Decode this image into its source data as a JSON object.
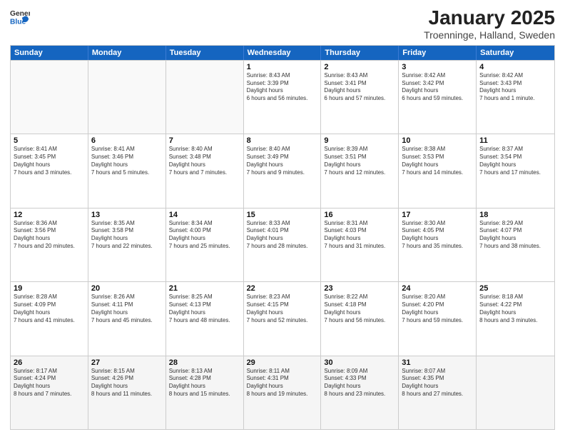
{
  "logo": {
    "general": "General",
    "blue": "Blue"
  },
  "header": {
    "month": "January 2025",
    "location": "Troenninge, Halland, Sweden"
  },
  "days": [
    "Sunday",
    "Monday",
    "Tuesday",
    "Wednesday",
    "Thursday",
    "Friday",
    "Saturday"
  ],
  "rows": [
    [
      {
        "day": "",
        "empty": true
      },
      {
        "day": "",
        "empty": true
      },
      {
        "day": "",
        "empty": true
      },
      {
        "day": "1",
        "sunrise": "8:43 AM",
        "sunset": "3:39 PM",
        "daylight": "6 hours and 56 minutes."
      },
      {
        "day": "2",
        "sunrise": "8:43 AM",
        "sunset": "3:41 PM",
        "daylight": "6 hours and 57 minutes."
      },
      {
        "day": "3",
        "sunrise": "8:42 AM",
        "sunset": "3:42 PM",
        "daylight": "6 hours and 59 minutes."
      },
      {
        "day": "4",
        "sunrise": "8:42 AM",
        "sunset": "3:43 PM",
        "daylight": "7 hours and 1 minute."
      }
    ],
    [
      {
        "day": "5",
        "sunrise": "8:41 AM",
        "sunset": "3:45 PM",
        "daylight": "7 hours and 3 minutes."
      },
      {
        "day": "6",
        "sunrise": "8:41 AM",
        "sunset": "3:46 PM",
        "daylight": "7 hours and 5 minutes."
      },
      {
        "day": "7",
        "sunrise": "8:40 AM",
        "sunset": "3:48 PM",
        "daylight": "7 hours and 7 minutes."
      },
      {
        "day": "8",
        "sunrise": "8:40 AM",
        "sunset": "3:49 PM",
        "daylight": "7 hours and 9 minutes."
      },
      {
        "day": "9",
        "sunrise": "8:39 AM",
        "sunset": "3:51 PM",
        "daylight": "7 hours and 12 minutes."
      },
      {
        "day": "10",
        "sunrise": "8:38 AM",
        "sunset": "3:53 PM",
        "daylight": "7 hours and 14 minutes."
      },
      {
        "day": "11",
        "sunrise": "8:37 AM",
        "sunset": "3:54 PM",
        "daylight": "7 hours and 17 minutes."
      }
    ],
    [
      {
        "day": "12",
        "sunrise": "8:36 AM",
        "sunset": "3:56 PM",
        "daylight": "7 hours and 20 minutes."
      },
      {
        "day": "13",
        "sunrise": "8:35 AM",
        "sunset": "3:58 PM",
        "daylight": "7 hours and 22 minutes."
      },
      {
        "day": "14",
        "sunrise": "8:34 AM",
        "sunset": "4:00 PM",
        "daylight": "7 hours and 25 minutes."
      },
      {
        "day": "15",
        "sunrise": "8:33 AM",
        "sunset": "4:01 PM",
        "daylight": "7 hours and 28 minutes."
      },
      {
        "day": "16",
        "sunrise": "8:31 AM",
        "sunset": "4:03 PM",
        "daylight": "7 hours and 31 minutes."
      },
      {
        "day": "17",
        "sunrise": "8:30 AM",
        "sunset": "4:05 PM",
        "daylight": "7 hours and 35 minutes."
      },
      {
        "day": "18",
        "sunrise": "8:29 AM",
        "sunset": "4:07 PM",
        "daylight": "7 hours and 38 minutes."
      }
    ],
    [
      {
        "day": "19",
        "sunrise": "8:28 AM",
        "sunset": "4:09 PM",
        "daylight": "7 hours and 41 minutes."
      },
      {
        "day": "20",
        "sunrise": "8:26 AM",
        "sunset": "4:11 PM",
        "daylight": "7 hours and 45 minutes."
      },
      {
        "day": "21",
        "sunrise": "8:25 AM",
        "sunset": "4:13 PM",
        "daylight": "7 hours and 48 minutes."
      },
      {
        "day": "22",
        "sunrise": "8:23 AM",
        "sunset": "4:15 PM",
        "daylight": "7 hours and 52 minutes."
      },
      {
        "day": "23",
        "sunrise": "8:22 AM",
        "sunset": "4:18 PM",
        "daylight": "7 hours and 56 minutes."
      },
      {
        "day": "24",
        "sunrise": "8:20 AM",
        "sunset": "4:20 PM",
        "daylight": "7 hours and 59 minutes."
      },
      {
        "day": "25",
        "sunrise": "8:18 AM",
        "sunset": "4:22 PM",
        "daylight": "8 hours and 3 minutes."
      }
    ],
    [
      {
        "day": "26",
        "sunrise": "8:17 AM",
        "sunset": "4:24 PM",
        "daylight": "8 hours and 7 minutes."
      },
      {
        "day": "27",
        "sunrise": "8:15 AM",
        "sunset": "4:26 PM",
        "daylight": "8 hours and 11 minutes."
      },
      {
        "day": "28",
        "sunrise": "8:13 AM",
        "sunset": "4:28 PM",
        "daylight": "8 hours and 15 minutes."
      },
      {
        "day": "29",
        "sunrise": "8:11 AM",
        "sunset": "4:31 PM",
        "daylight": "8 hours and 19 minutes."
      },
      {
        "day": "30",
        "sunrise": "8:09 AM",
        "sunset": "4:33 PM",
        "daylight": "8 hours and 23 minutes."
      },
      {
        "day": "31",
        "sunrise": "8:07 AM",
        "sunset": "4:35 PM",
        "daylight": "8 hours and 27 minutes."
      },
      {
        "day": "",
        "empty": true
      }
    ]
  ]
}
